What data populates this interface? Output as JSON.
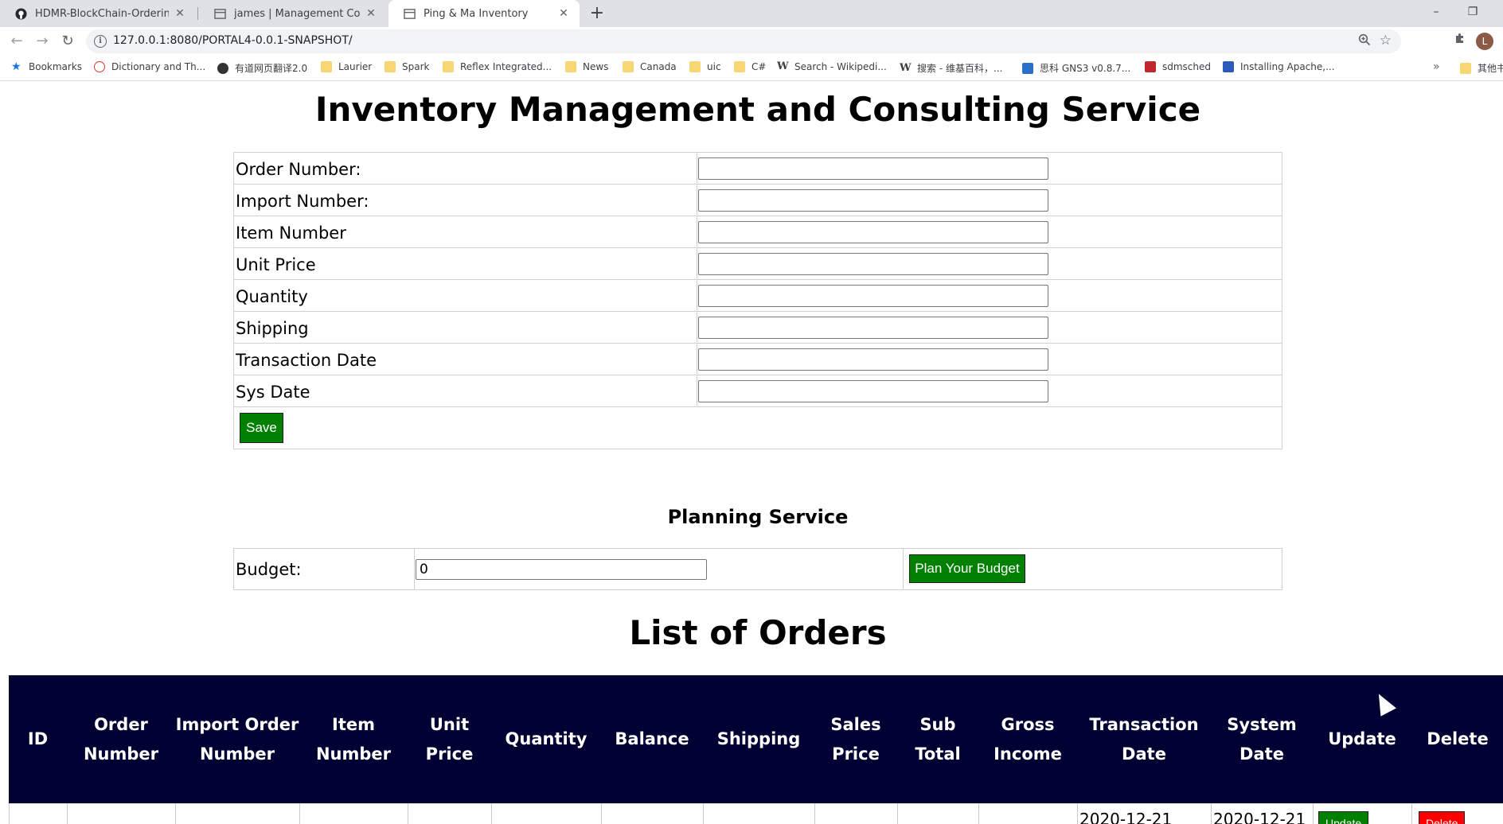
{
  "browser": {
    "tabs": [
      {
        "title": "HDMR-BlockChain-Ordering/",
        "icon": "github-icon"
      },
      {
        "title": "james | Management Console",
        "icon": "console-icon"
      },
      {
        "title": "Ping & Ma Inventory",
        "icon": "page-icon",
        "active": true
      }
    ],
    "new_tab": "+",
    "window_controls": [
      "–",
      "❐"
    ],
    "url": "127.0.0.1:8080/PORTAL4-0.0.1-SNAPSHOT/",
    "profile_initial": "L",
    "bookmarks": [
      {
        "label": "Bookmarks",
        "icon": "star-icon"
      },
      {
        "label": "Dictionary and Th...",
        "icon": "mw-icon"
      },
      {
        "label": "有道网页翻译2.0",
        "icon": "globe-icon"
      },
      {
        "label": "Laurier",
        "icon": "folder-icon"
      },
      {
        "label": "Spark",
        "icon": "folder-icon"
      },
      {
        "label": "Reflex Integrated...",
        "icon": "folder-icon"
      },
      {
        "label": "News",
        "icon": "folder-icon"
      },
      {
        "label": "Canada",
        "icon": "folder-icon"
      },
      {
        "label": "uic",
        "icon": "folder-icon"
      },
      {
        "label": "C#",
        "icon": "folder-icon"
      },
      {
        "label": "Search - Wikipedi...",
        "icon": "wikipedia-icon"
      },
      {
        "label": "搜索 - 维基百科，...",
        "icon": "wikipedia-icon"
      },
      {
        "label": "思科 GNS3 v0.8.7...",
        "icon": "gns3-icon"
      },
      {
        "label": "sdmsched",
        "icon": "sdm-icon"
      },
      {
        "label": "Installing Apache,...",
        "icon": "box-icon"
      },
      {
        "label": "其他书",
        "icon": "folder-icon"
      }
    ],
    "bookmarks_more": "»"
  },
  "page": {
    "title": "Inventory Management and Consulting Service",
    "form": {
      "fields": [
        {
          "label": "Order Number:",
          "value": ""
        },
        {
          "label": "Import Number:",
          "value": ""
        },
        {
          "label": "Item Number",
          "value": ""
        },
        {
          "label": "Unit Price",
          "value": ""
        },
        {
          "label": "Quantity",
          "value": ""
        },
        {
          "label": "Shipping",
          "value": ""
        },
        {
          "label": "Transaction Date",
          "value": ""
        },
        {
          "label": "Sys Date",
          "value": ""
        }
      ],
      "save_label": "Save"
    },
    "planning": {
      "title": "Planning Service",
      "budget_label": "Budget:",
      "budget_value": "0",
      "plan_button": "Plan Your Budget"
    },
    "orders": {
      "title": "List of Orders",
      "columns": [
        "ID",
        "Order Number",
        "Import Order Number",
        "Item Number",
        "Unit Price",
        "Quantity",
        "Balance",
        "Shipping",
        "Sales Price",
        "Sub Total",
        "Gross Income",
        "Transaction Date",
        "System Date",
        "Update",
        "Delete"
      ],
      "rows": [
        {
          "transaction_date": "2020-12-21",
          "system_date": "2020-12-21",
          "update": "Update",
          "delete": "Delete"
        }
      ]
    },
    "colors": {
      "header_bg": "#000033",
      "green_button": "#008000",
      "red_button": "#ff0000"
    }
  }
}
